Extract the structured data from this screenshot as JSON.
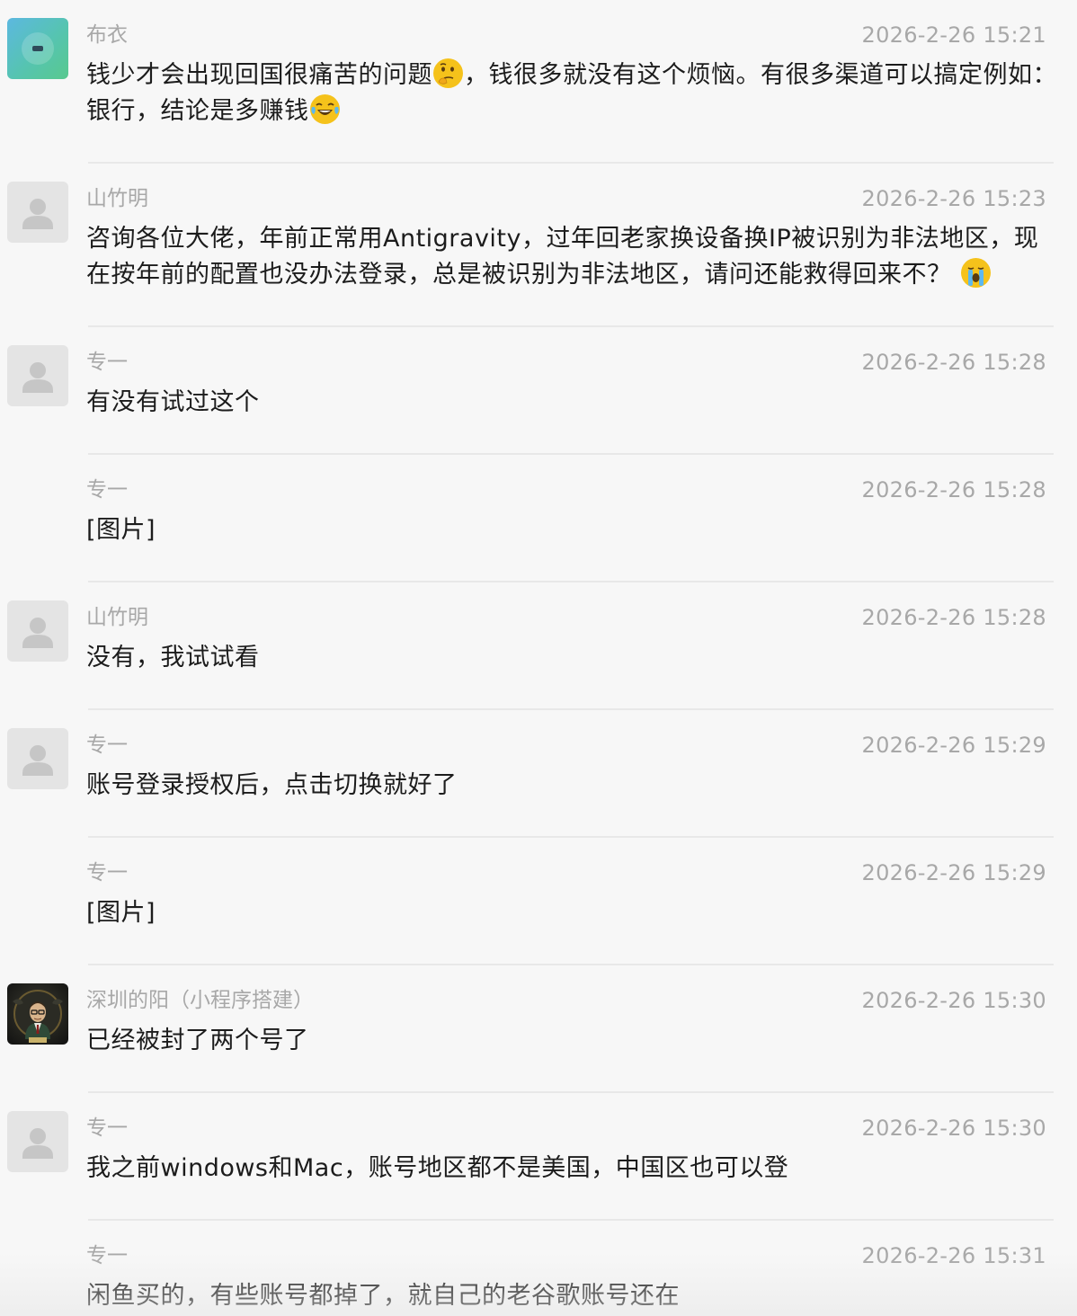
{
  "messages": [
    {
      "sender": "布衣",
      "time": "2026-2-26 15:21",
      "text_parts": [
        "钱少才会出现回国很痛苦的问题",
        "，钱很多就没有这个烦恼。有很多渠道可以搞定例如：银行，结论是多赚钱"
      ],
      "emojis": [
        "thinking-face-icon",
        "tears-of-joy-icon"
      ],
      "avatar": "teal-avatar"
    },
    {
      "sender": "山竹明",
      "time": "2026-2-26 15:23",
      "text_parts": [
        "咨询各位大佬，年前正常用Antigravity，过年回老家换设备换IP被识别为非法地区，现在按年前的配置也没办法登录，总是被识别为非法地区，请问还能救得回来不？"
      ],
      "emojis": [
        "crying-face-icon"
      ],
      "avatar": "default-avatar"
    },
    {
      "sender": "专一",
      "time": "2026-2-26 15:28",
      "text": "有没有试过这个",
      "avatar": "default-avatar"
    },
    {
      "sender": "专一",
      "time": "2026-2-26 15:28",
      "text": "[图片]",
      "avatar": "none"
    },
    {
      "sender": "山竹明",
      "time": "2026-2-26 15:28",
      "text": "没有，我试试看",
      "avatar": "default-avatar"
    },
    {
      "sender": "专一",
      "time": "2026-2-26 15:29",
      "text": "账号登录授权后，点击切换就好了",
      "avatar": "default-avatar"
    },
    {
      "sender": "专一",
      "time": "2026-2-26 15:29",
      "text": "[图片]",
      "avatar": "none"
    },
    {
      "sender": "深圳的阳（小程序搭建）",
      "time": "2026-2-26 15:30",
      "text": "已经被封了两个号了",
      "avatar": "photo-avatar"
    },
    {
      "sender": "专一",
      "time": "2026-2-26 15:30",
      "text": "我之前windows和Mac，账号地区都不是美国，中国区也可以登",
      "avatar": "default-avatar"
    },
    {
      "sender": "专一",
      "time": "2026-2-26 15:31",
      "text": "闲鱼买的，有些账号都掉了，就自己的老谷歌账号还在",
      "avatar": "none"
    }
  ],
  "colors": {
    "background": "#f7f7f7",
    "meta_text": "#a8a8a8",
    "body_text": "#1c1c1c",
    "divider": "#e8e8e8"
  }
}
